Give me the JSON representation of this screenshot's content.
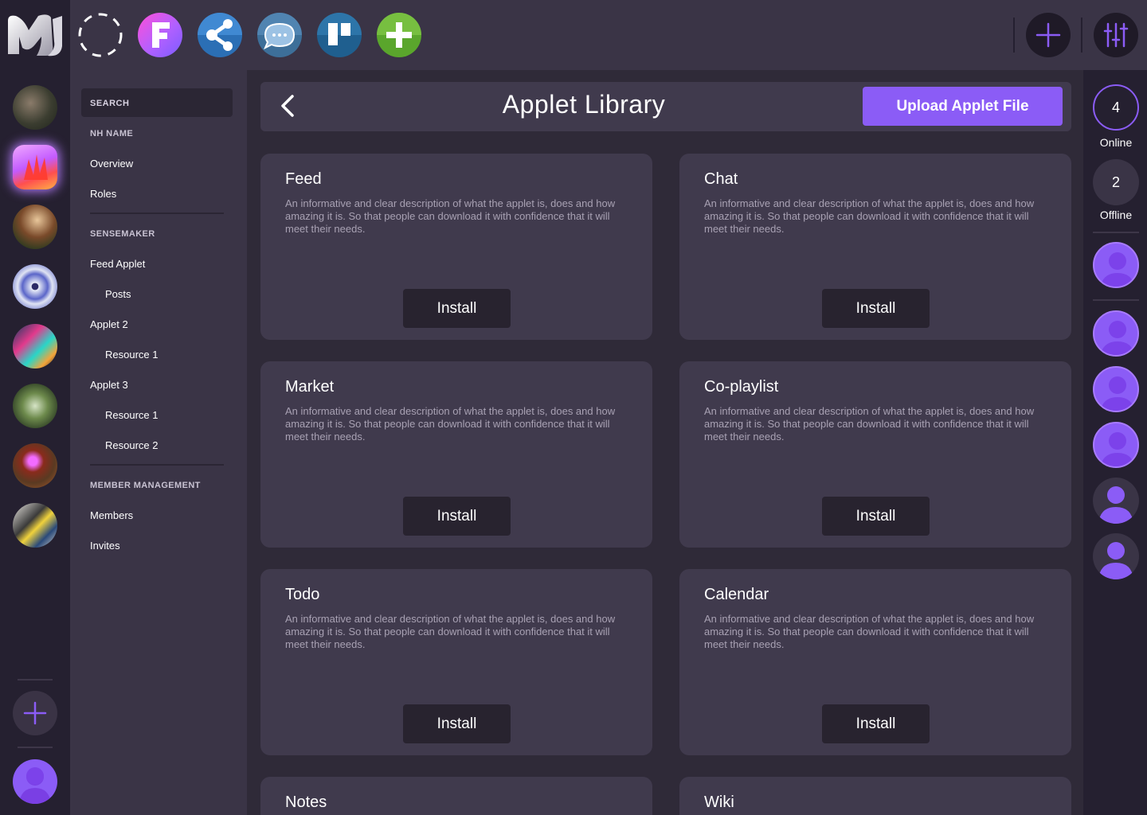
{
  "colors": {
    "accent": "#8b5cf6",
    "background": "#2f2a38",
    "panel": "#3a3446",
    "card": "#403a4d"
  },
  "icons": {
    "logo": "nh-logo-icon",
    "top_apps": [
      "dashed-circle-icon",
      "f-letter-app-icon",
      "share-app-icon",
      "chat-bubble-app-icon",
      "board-app-icon",
      "plus-app-icon"
    ],
    "top_right": [
      "plus-icon",
      "sliders-icon"
    ],
    "back": "chevron-left-icon"
  },
  "nav": {
    "search": "SEARCH",
    "section1": "NH NAME",
    "overview": "Overview",
    "roles": "Roles",
    "section2": "SENSEMAKER",
    "feed_applet": "Feed Applet",
    "posts": "Posts",
    "applet2": "Applet 2",
    "applet2_res1": "Resource 1",
    "applet3": "Applet 3",
    "applet3_res1": "Resource 1",
    "applet3_res2": "Resource 2",
    "section3": "MEMBER MANAGEMENT",
    "members": "Members",
    "invites": "Invites"
  },
  "header": {
    "title": "Applet Library",
    "upload": "Upload Applet File"
  },
  "applets": [
    {
      "name": "Feed",
      "description": "An informative and clear description of what the applet is, does and how amazing it is. So that people can download it with confidence that it will meet their needs.",
      "action": "Install"
    },
    {
      "name": "Chat",
      "description": "An informative and clear description of what the applet is, does and how amazing it is. So that people can download it with confidence that it will meet their needs.",
      "action": "Install"
    },
    {
      "name": "Market",
      "description": "An informative and clear description of what the applet is, does and how amazing it is. So that people can download it with confidence that it will meet their needs.",
      "action": "Install"
    },
    {
      "name": "Co-playlist",
      "description": "An informative and clear description of what the applet is, does and how amazing it is. So that people can download it with confidence that it will meet their needs.",
      "action": "Install"
    },
    {
      "name": "Todo",
      "description": "An informative and clear description of what the applet is, does and how amazing it is. So that people can download it with confidence that it will meet their needs.",
      "action": "Install"
    },
    {
      "name": "Calendar",
      "description": "An informative and clear description of what the applet is, does and how amazing it is. So that people can download it with confidence that it will meet their needs.",
      "action": "Install"
    },
    {
      "name": "Notes"
    },
    {
      "name": "Wiki"
    }
  ],
  "presence": {
    "online_count": "4",
    "online_label": "Online",
    "offline_count": "2",
    "offline_label": "Offline"
  }
}
